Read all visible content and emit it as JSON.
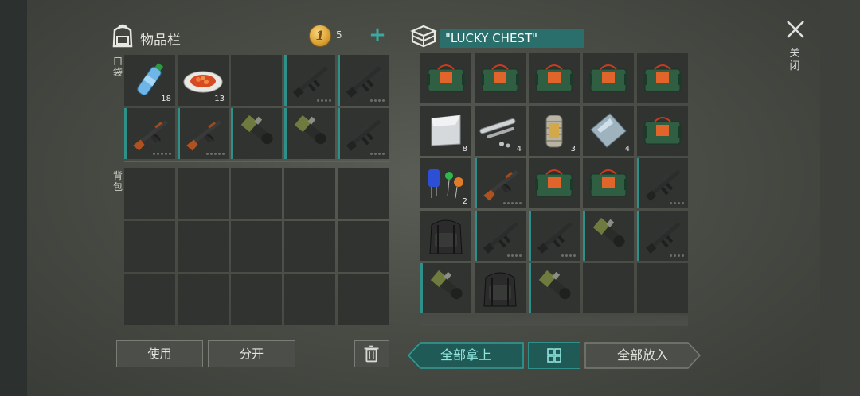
{
  "inventory": {
    "title": "物品栏",
    "icon": "backpack-icon",
    "coins": "5",
    "pockets_label": "口袋",
    "backpack_label": "背包",
    "pockets": [
      {
        "item": "water-bottle",
        "count": "18",
        "marked": false
      },
      {
        "item": "food-plate",
        "count": "13",
        "marked": false
      },
      {
        "item": "empty",
        "marked": false
      },
      {
        "item": "m16-rifle",
        "durability": 4,
        "marked": true
      },
      {
        "item": "m16-rifle",
        "durability": 4,
        "marked": true
      },
      {
        "item": "ak-rifle",
        "durability": 5,
        "marked": true
      },
      {
        "item": "ak-rifle",
        "durability": 5,
        "marked": true
      },
      {
        "item": "grenade-launcher",
        "marked": true
      },
      {
        "item": "grenade-launcher",
        "marked": true
      },
      {
        "item": "m16-rifle",
        "durability": 4,
        "marked": true
      }
    ],
    "backpack_slots": 15
  },
  "chest": {
    "name": "\"LUCKY CHEST\"",
    "icon": "crate-icon",
    "items": [
      {
        "item": "explosive-case",
        "marked": false
      },
      {
        "item": "explosive-case",
        "marked": false
      },
      {
        "item": "explosive-case",
        "marked": false
      },
      {
        "item": "explosive-case",
        "marked": false
      },
      {
        "item": "explosive-case",
        "marked": false
      },
      {
        "item": "metal-sheet",
        "count": "8",
        "marked": false
      },
      {
        "item": "pipe-parts",
        "count": "4",
        "marked": false
      },
      {
        "item": "spring-part",
        "count": "3",
        "marked": false
      },
      {
        "item": "glass-plate",
        "count": "4",
        "marked": false
      },
      {
        "item": "explosive-case",
        "marked": false
      },
      {
        "item": "electronic-parts",
        "count": "2",
        "marked": false
      },
      {
        "item": "ak-rifle",
        "durability": 5,
        "marked": true
      },
      {
        "item": "explosive-case",
        "marked": false
      },
      {
        "item": "explosive-case",
        "marked": false
      },
      {
        "item": "m16-rifle",
        "durability": 4,
        "marked": true
      },
      {
        "item": "tactical-backpack",
        "marked": false
      },
      {
        "item": "m16-rifle",
        "durability": 4,
        "marked": true
      },
      {
        "item": "m16-rifle",
        "durability": 4,
        "marked": true
      },
      {
        "item": "grenade-launcher",
        "marked": true
      },
      {
        "item": "m16-rifle",
        "durability": 4,
        "marked": true
      },
      {
        "item": "grenade-launcher",
        "marked": true
      },
      {
        "item": "tactical-backpack",
        "marked": false
      },
      {
        "item": "grenade-launcher",
        "marked": true
      },
      {
        "item": "empty",
        "marked": false
      },
      {
        "item": "empty",
        "marked": false
      }
    ]
  },
  "buttons": {
    "use": "使用",
    "split": "分开",
    "take_all": "全部拿上",
    "put_all": "全部放入"
  },
  "close_label": "关闭",
  "colors": {
    "accent": "#2f8f89",
    "chest_name_bg": "#2a6f6b",
    "cell_bg": "#30332f",
    "panel_bg": "#4a4d46"
  }
}
